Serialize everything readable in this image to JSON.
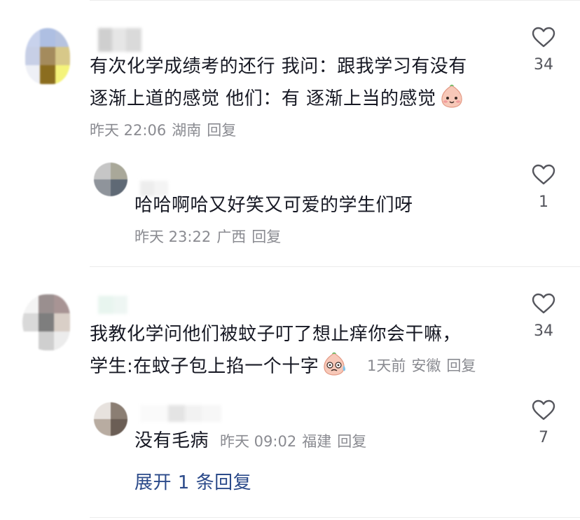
{
  "comments": [
    {
      "line1": "有次化学成绩考的还行 我问：跟我学习有没有",
      "line2": "逐渐上道的感觉 他们：有 逐渐上当的感觉",
      "emoji": "blush-peach-emoji",
      "time": "昨天 22:06",
      "location": "湖南",
      "reply_label": "回复",
      "likes": "34",
      "reply": {
        "text": "哈哈啊哈又好笑又可爱的学生们呀",
        "time": "昨天 23:22",
        "location": "广西",
        "reply_label": "回复",
        "likes": "1"
      }
    },
    {
      "line1": "我教化学问他们被蚊子叮了想止痒你会干嘛，",
      "line2": "学生:在蚊子包上掐一个十字",
      "emoji": "sweat-peach-emoji",
      "time": "1天前",
      "location": "安徽",
      "reply_label": "回复",
      "likes": "34",
      "reply": {
        "text": "没有毛病",
        "time": "昨天 09:02",
        "location": "福建",
        "reply_label": "回复",
        "likes": "7"
      },
      "expand_label": "展开 1 条回复"
    }
  ],
  "colors": {
    "text": "#161823",
    "meta": "#8a8b91",
    "link": "#2b4a8a"
  }
}
